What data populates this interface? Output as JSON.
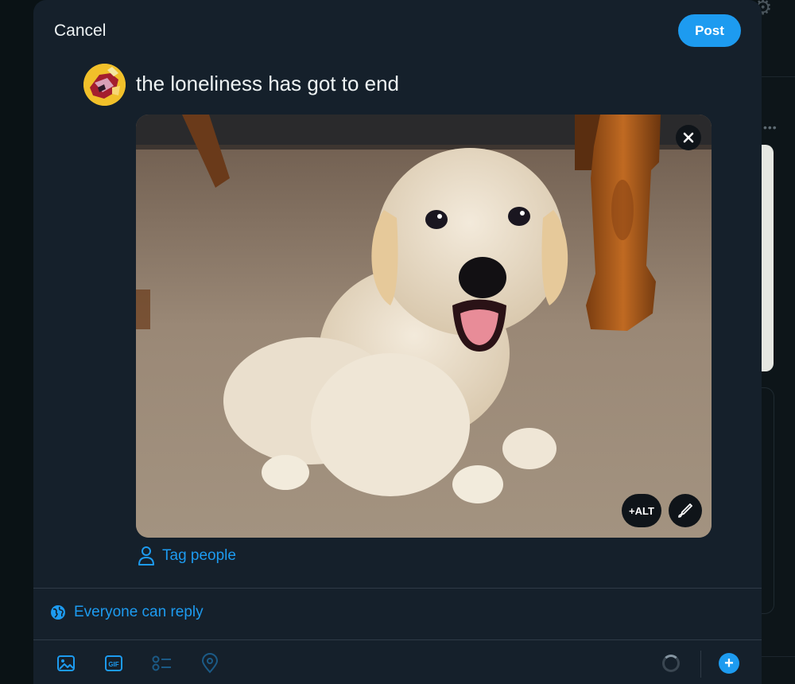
{
  "compose": {
    "cancel_label": "Cancel",
    "post_label": "Post",
    "text": "the loneliness has got to end",
    "alt_label": "+ALT",
    "tag_people_label": "Tag people",
    "reply_setting_label": "Everyone can reply"
  },
  "icons": {
    "remove_media": "close-icon",
    "edit_media": "pencil-icon",
    "tag_people": "person-icon",
    "reply_setting": "globe-icon",
    "toolbar": [
      "image-icon",
      "gif-icon",
      "poll-icon",
      "location-icon"
    ]
  },
  "colors": {
    "accent": "#1d9bf0",
    "modal_background": "#15202b",
    "text_primary": "#eef3f4",
    "divider": "#2f3b47"
  }
}
